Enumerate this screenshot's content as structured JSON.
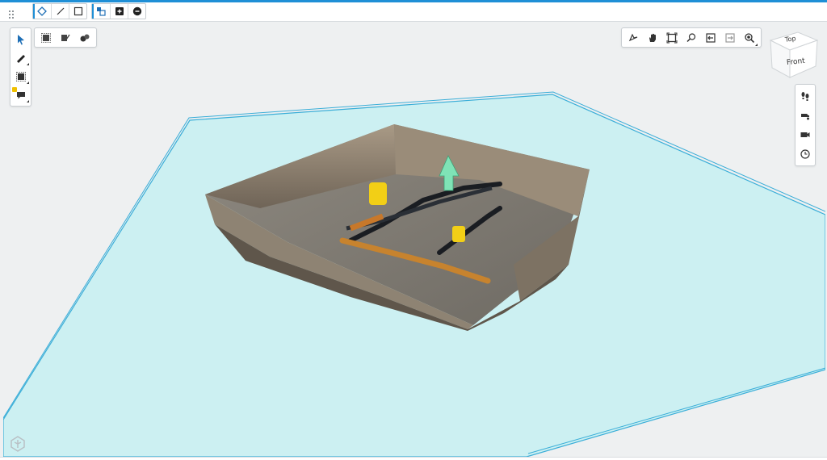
{
  "window": {
    "accent_color": "#1f8fd6"
  },
  "top_toolbar": {
    "groups": [
      {
        "buttons": [
          {
            "name": "point-snap-button",
            "icon": "diamond-snap-icon",
            "active": true
          },
          {
            "name": "line-tool-button",
            "icon": "line-icon"
          },
          {
            "name": "rectangle-tool-button",
            "icon": "rectangle-icon"
          }
        ]
      },
      {
        "buttons": [
          {
            "name": "select-layers-button",
            "icon": "layers-select-icon",
            "active": true
          },
          {
            "name": "add-button",
            "icon": "plus-square-icon"
          },
          {
            "name": "remove-button",
            "icon": "minus-circle-icon"
          }
        ]
      }
    ]
  },
  "left_tools": [
    {
      "name": "select-tool",
      "icon": "cursor-arrow-icon"
    },
    {
      "name": "measure-tool",
      "icon": "ruler-icon"
    },
    {
      "name": "clipping-tool",
      "icon": "clip-box-icon"
    },
    {
      "name": "annotation-tool",
      "icon": "comment-icon"
    }
  ],
  "sub_tools": [
    {
      "name": "clip-box-show-button",
      "icon": "clip-box-show-icon"
    },
    {
      "name": "clip-box-edit-button",
      "icon": "clip-box-edit-icon"
    },
    {
      "name": "objects-button",
      "icon": "spheres-icon"
    }
  ],
  "view_tools": [
    {
      "name": "orbit-button",
      "icon": "orbit-icon"
    },
    {
      "name": "pan-button",
      "icon": "hand-icon"
    },
    {
      "name": "fit-view-button",
      "icon": "fit-frame-icon"
    },
    {
      "name": "zoom-window-button",
      "icon": "zoom-window-icon"
    },
    {
      "name": "previous-view-button",
      "icon": "previous-view-icon"
    },
    {
      "name": "next-view-button",
      "icon": "next-view-icon"
    },
    {
      "name": "zoom-button",
      "icon": "magnifier-icon"
    }
  ],
  "right_tools": [
    {
      "name": "walk-mode-button",
      "icon": "footsteps-icon"
    },
    {
      "name": "fly-mode-button",
      "icon": "fly-icon"
    },
    {
      "name": "camera-button",
      "icon": "camera-icon"
    },
    {
      "name": "clock-button",
      "icon": "clock-icon"
    }
  ],
  "view_cube": {
    "top_label": "Top",
    "front_label": "Front"
  },
  "scene": {
    "plane_color": "#ccf0f2",
    "plane_edge_color": "#3aaed8",
    "arrow_color": "#7fe3b6"
  }
}
